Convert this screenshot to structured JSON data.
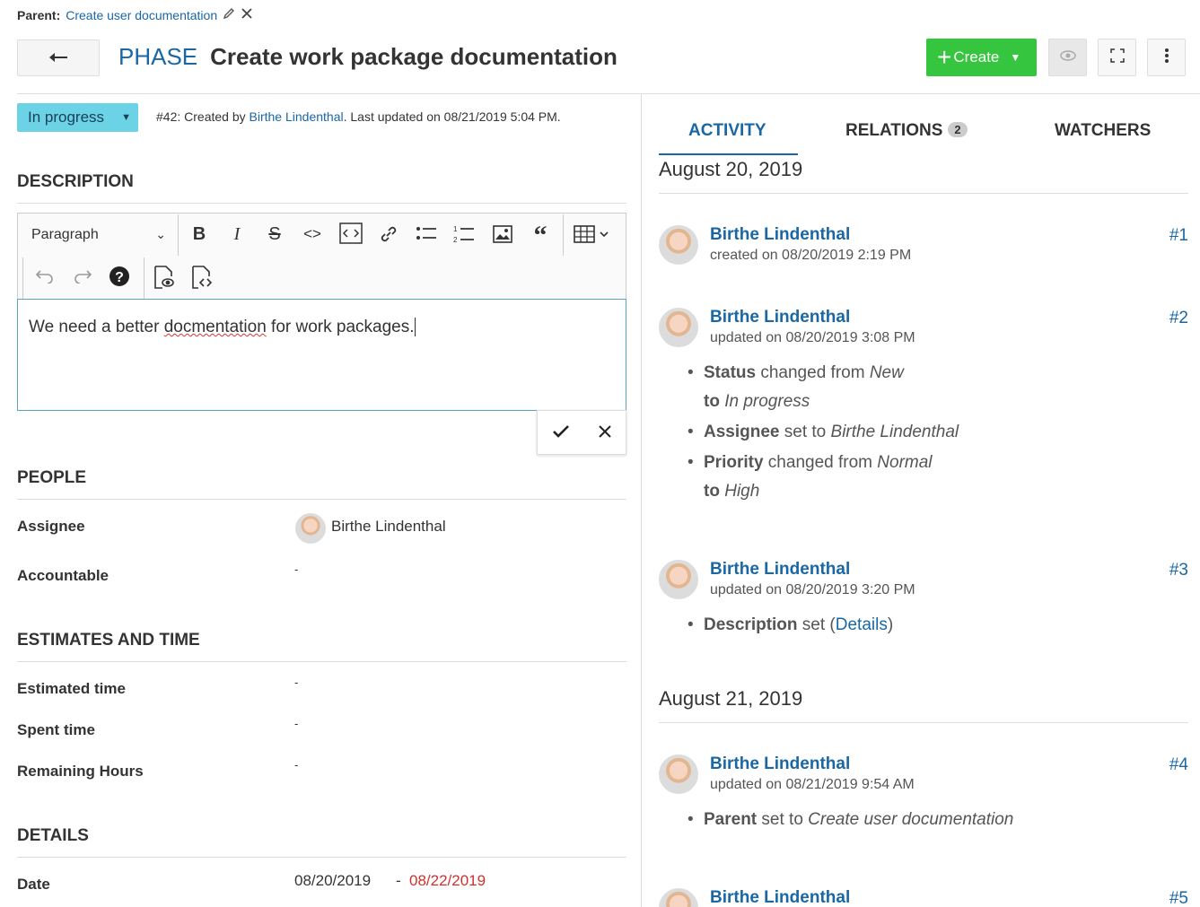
{
  "parent": {
    "label": "Parent:",
    "link": "Create user documentation"
  },
  "header": {
    "type": "PHASE",
    "subject": "Create work package documentation",
    "create_label": "Create"
  },
  "status": {
    "value": "In progress",
    "meta_prefix": "#42: Created by ",
    "meta_author": "Birthe Lindenthal",
    "meta_suffix": ". Last updated on 08/21/2019 5:04 PM."
  },
  "sections": {
    "description": "DESCRIPTION",
    "people": "PEOPLE",
    "estimates": "ESTIMATES AND TIME",
    "details": "DETAILS"
  },
  "editor": {
    "paragraph": "Paragraph",
    "text_before": "We need a better ",
    "text_misspelled": "docmentation",
    "text_after": " for work packages."
  },
  "people": {
    "assignee_label": "Assignee",
    "assignee_value": "Birthe Lindenthal",
    "accountable_label": "Accountable",
    "accountable_value": "-"
  },
  "estimates": {
    "estimated_label": "Estimated time",
    "estimated_value": "-",
    "spent_label": "Spent time",
    "spent_value": "-",
    "remaining_label": "Remaining Hours",
    "remaining_value": "-"
  },
  "details": {
    "date_label": "Date",
    "start": "08/20/2019",
    "sep": "-",
    "end": "08/22/2019",
    "end_color": "#d0312d"
  },
  "tabs": {
    "activity": "ACTIVITY",
    "relations": "RELATIONS",
    "relations_count": "2",
    "watchers": "WATCHERS"
  },
  "activity": {
    "day1": "August 20, 2019",
    "day2": "August 21, 2019",
    "entries": [
      {
        "user": "Birthe Lindenthal",
        "sub": "created on 08/20/2019 2:19 PM",
        "num": "#1"
      },
      {
        "user": "Birthe Lindenthal",
        "sub": "updated on 08/20/2019 3:08 PM",
        "num": "#2",
        "c1_field": "Status",
        "c1_mid": " changed from ",
        "c1_from": "New",
        "c1_to_lbl": "to ",
        "c1_to": "In progress",
        "c2_field": "Assignee",
        "c2_mid": " set to ",
        "c2_val": "Birthe Lindenthal",
        "c3_field": "Priority",
        "c3_mid": " changed from ",
        "c3_from": "Normal",
        "c3_to_lbl": "to ",
        "c3_to": "High"
      },
      {
        "user": "Birthe Lindenthal",
        "sub": "updated on 08/20/2019 3:20 PM",
        "num": "#3",
        "c1_field": "Description",
        "c1_mid": " set (",
        "c1_link": "Details",
        "c1_end": ")"
      },
      {
        "user": "Birthe Lindenthal",
        "sub": "updated on 08/21/2019 9:54 AM",
        "num": "#4",
        "c1_field": "Parent",
        "c1_mid": " set to ",
        "c1_val": "Create user documentation"
      },
      {
        "user": "Birthe Lindenthal",
        "num": "#5"
      }
    ]
  }
}
